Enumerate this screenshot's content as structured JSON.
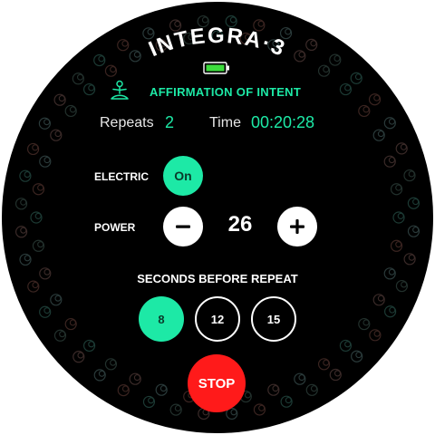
{
  "device": {
    "title": "INTEGRA·3",
    "battery_icon": "battery-icon",
    "battery_color": "#3ddc3d"
  },
  "program": {
    "icon": "meditation-icon",
    "name": "AFFIRMATION OF INTENT"
  },
  "stats": {
    "repeats_label": "Repeats",
    "repeats_value": "2",
    "time_label": "Time",
    "time_value": "00:20:28"
  },
  "electric": {
    "label": "ELECTRIC",
    "toggle_label": "On"
  },
  "power": {
    "label": "POWER",
    "value": "26",
    "minus_icon": "minus-icon",
    "plus_icon": "plus-icon"
  },
  "seconds_before_repeat": {
    "title": "SECONDS BEFORE REPEAT",
    "options": [
      "8",
      "12",
      "15"
    ],
    "selected": "8"
  },
  "stop": {
    "label": "STOP",
    "color": "#ff1a1a"
  },
  "colors": {
    "accent": "#1de9a6",
    "background": "#000000"
  }
}
